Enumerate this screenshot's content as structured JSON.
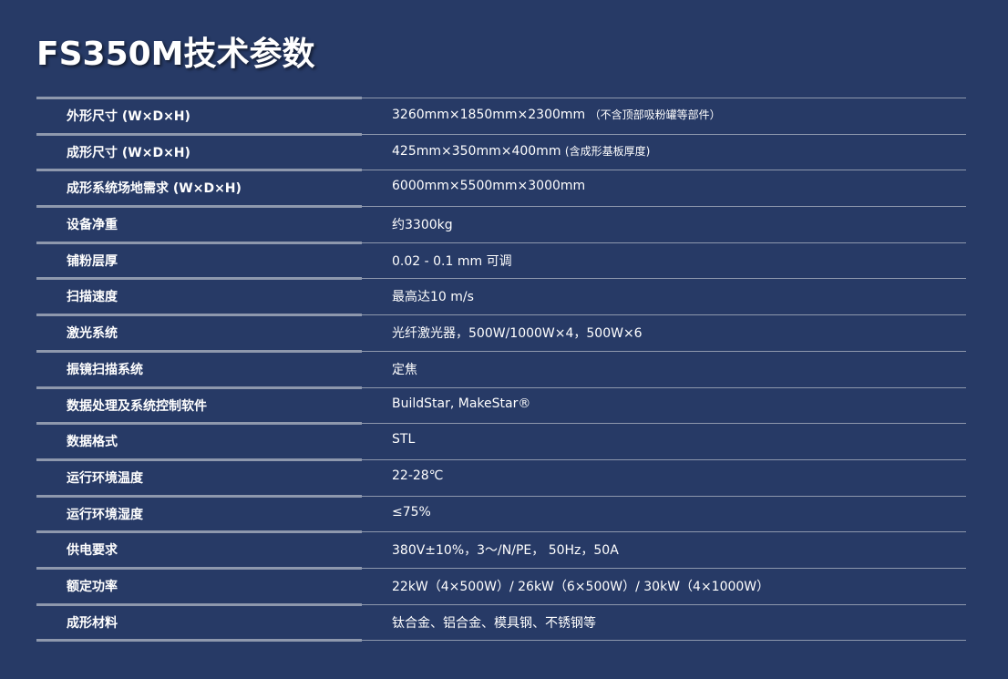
{
  "title": "FS350M技术参数",
  "specs": [
    {
      "label": "外形尺寸 (W×D×H)",
      "value": "3260mm×1850mm×2300mm",
      "note": "（不含顶部吸粉罐等部件）"
    },
    {
      "label": "成形尺寸 (W×D×H)",
      "value": "425mm×350mm×400mm",
      "note": "(含成形基板厚度)"
    },
    {
      "label": "成形系统场地需求 (W×D×H)",
      "value": "6000mm×5500mm×3000mm",
      "note": ""
    },
    {
      "label": "设备净重",
      "value": "约3300kg",
      "note": ""
    },
    {
      "label": "铺粉层厚",
      "value": "0.02 - 0.1 mm 可调",
      "note": ""
    },
    {
      "label": "扫描速度",
      "value": "最高达10 m/s",
      "note": ""
    },
    {
      "label": "激光系统",
      "value": "光纤激光器，500W/1000W×4，500W×6",
      "note": ""
    },
    {
      "label": "振镜扫描系统",
      "value": "定焦",
      "note": ""
    },
    {
      "label": "数据处理及系统控制软件",
      "value": "BuildStar, MakeStar®",
      "note": ""
    },
    {
      "label": "数据格式",
      "value": "STL",
      "note": ""
    },
    {
      "label": "运行环境温度",
      "value": "22-28℃",
      "note": ""
    },
    {
      "label": "运行环境湿度",
      "value": "≤75%",
      "note": ""
    },
    {
      "label": "供电要求",
      "value": "380V±10%，3～/N/PE， 50Hz，50A",
      "note": ""
    },
    {
      "label": "额定功率",
      "value": "22kW（4×500W）/ 26kW（6×500W）/ 30kW（4×1000W）",
      "note": ""
    },
    {
      "label": "成形材料",
      "value": "钛合金、铝合金、模具钢、不锈钢等",
      "note": ""
    }
  ]
}
